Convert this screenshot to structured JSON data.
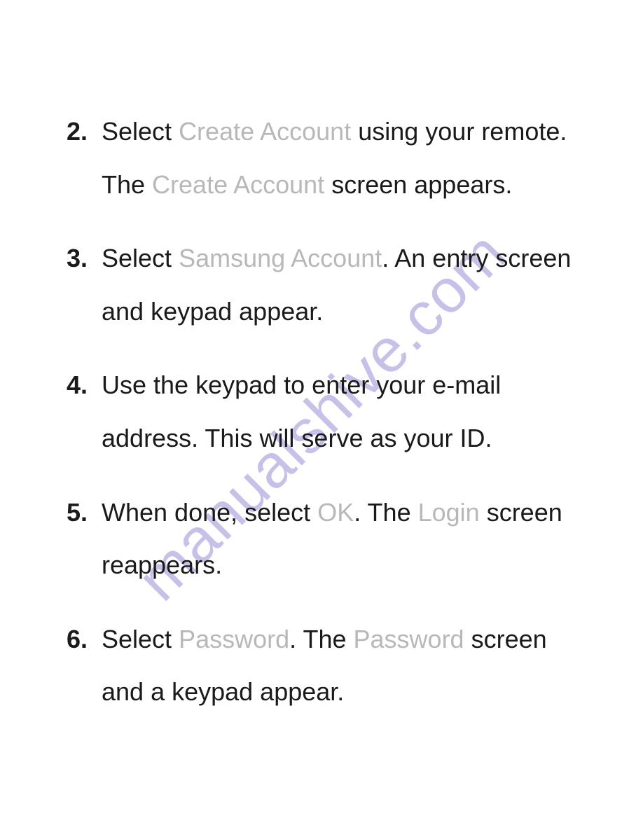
{
  "watermark": "manualshive.com",
  "steps": [
    {
      "num": "2",
      "segments": [
        {
          "t": "Select ",
          "hl": false
        },
        {
          "t": "Create Account",
          "hl": true
        },
        {
          "t": " using your remote. The ",
          "hl": false
        },
        {
          "t": "Create Account",
          "hl": true
        },
        {
          "t": " screen appears.",
          "hl": false
        }
      ]
    },
    {
      "num": "3",
      "segments": [
        {
          "t": "Select ",
          "hl": false
        },
        {
          "t": "Samsung Account",
          "hl": true
        },
        {
          "t": ". An entry screen and keypad appear.",
          "hl": false
        }
      ]
    },
    {
      "num": "4",
      "segments": [
        {
          "t": "Use the keypad to enter your e-mail address. This will serve as your ID.",
          "hl": false
        }
      ]
    },
    {
      "num": "5",
      "segments": [
        {
          "t": "When done, select ",
          "hl": false
        },
        {
          "t": "OK",
          "hl": true
        },
        {
          "t": ". The ",
          "hl": false
        },
        {
          "t": "Login",
          "hl": true
        },
        {
          "t": " screen reappears.",
          "hl": false
        }
      ]
    },
    {
      "num": "6",
      "segments": [
        {
          "t": "Select ",
          "hl": false
        },
        {
          "t": "Password",
          "hl": true
        },
        {
          "t": ". The ",
          "hl": false
        },
        {
          "t": "Password",
          "hl": true
        },
        {
          "t": " screen and a keypad appear.",
          "hl": false
        }
      ]
    }
  ]
}
